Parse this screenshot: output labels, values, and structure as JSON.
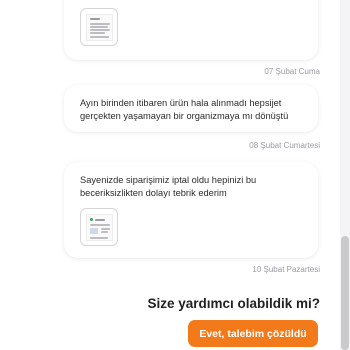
{
  "messages": [
    {
      "text": "",
      "timestamp": "07 Şubat Cuma",
      "has_attachment": true
    },
    {
      "text": "Ayın birinden itibaren ürün hala alınmadı hepsijet gerçekten yaşamayan bir organizmaya mı dönüştü",
      "timestamp": "08 Şubat Cumartesi",
      "has_attachment": false
    },
    {
      "text": "Sayenizde siparişimiz iptal oldu hepinizi bu beceriksizlikten dolayı tebrik ederim",
      "timestamp": "10 Şubat Pazartesi",
      "has_attachment": true
    }
  ],
  "feedback": {
    "question": "Size yardımcı olabildik mi?",
    "resolved_button_label": "Evet, talebim çözüldü"
  },
  "colors": {
    "accent": "#f27a1a",
    "timestamp": "#9b9ba2",
    "card_shadow": "#e6e6ea"
  },
  "icons": {
    "attachment": "document-thumbnail-icon"
  }
}
